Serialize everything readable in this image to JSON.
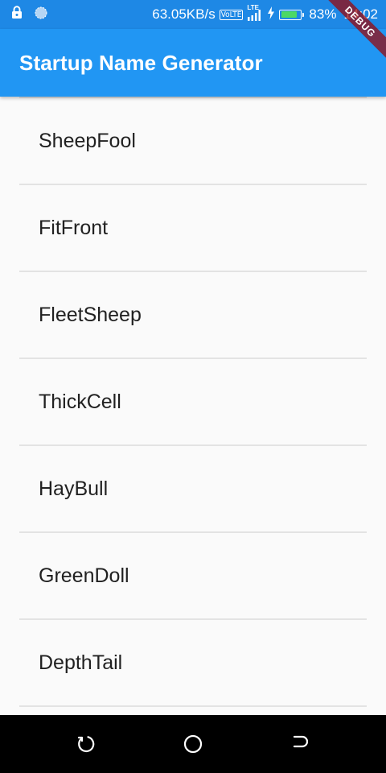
{
  "status_bar": {
    "network_speed": "63.05KB/s",
    "volte": "VoLTE",
    "lte": "LTE",
    "battery_percent": "83%",
    "battery_level": 0.83,
    "time": "14:02"
  },
  "app_bar": {
    "title": "Startup Name Generator"
  },
  "debug_banner": "DEBUG",
  "list": {
    "items": [
      "SheepFool",
      "FitFront",
      "FleetSheep",
      "ThickCell",
      "HayBull",
      "GreenDoll",
      "DepthTail"
    ]
  },
  "colors": {
    "app_bar": "#2196f3",
    "status_bar": "#1e88e5",
    "battery_fill": "#4cd964",
    "divider": "#e3e3e3"
  },
  "icons": {
    "status_left": [
      "lock-icon",
      "sync-icon"
    ],
    "status_right": [
      "lte-signal-icon",
      "charging-icon",
      "battery-icon"
    ],
    "nav": [
      "recent-apps-icon",
      "home-icon",
      "back-icon"
    ]
  }
}
